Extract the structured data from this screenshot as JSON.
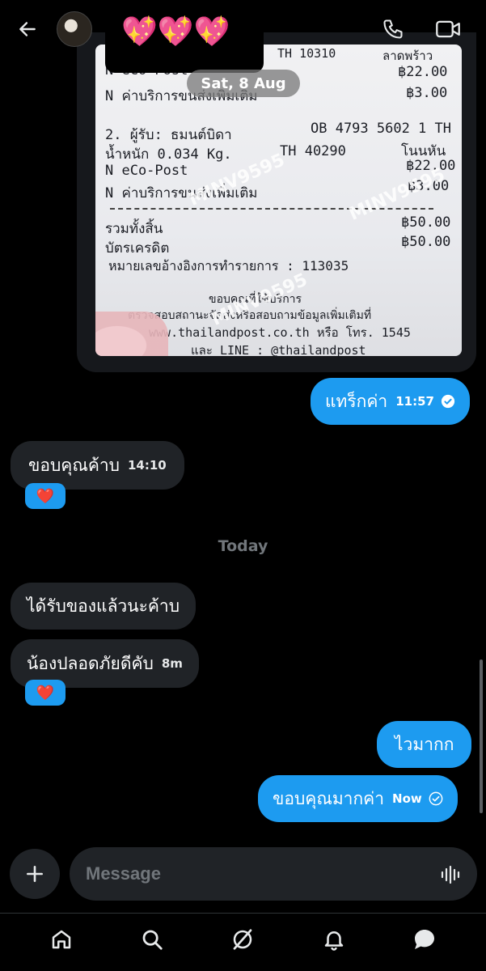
{
  "header": {
    "back_icon": "arrow-left-icon",
    "contact_name": "💖💖💖",
    "call_icon": "phone-icon",
    "video_icon": "video-camera-icon"
  },
  "media": {
    "receipt_lines": [
      "N eCo-Post",
      "N ค่าบริการขนส่งเพิ่มเติม",
      "2. ผู้รับ: ธมนต์บิดา",
      "น้ำหนัก 0.034 Kg.",
      "N eCo-Post",
      "N ค่าบริการขนส่งเพิ่มเติม",
      "รวมทั้งสิ้น",
      "บัตรเครดิต",
      "หมายเลขอ้างอิงการทำรายการ : 113035",
      "ขอบคุณที่ใช้บริการ",
      "ตรวจสอบสถานะจัดส่งหรือสอบถามข้อมูลเพิ่มเติมที่",
      "www.thailandpost.co.th หรือ โทร. 1545",
      "และ LINE : @thailandpost"
    ],
    "receipt_right": [
      "TH 10310",
      "ลาดพร้าว",
      "฿22.00",
      "฿3.00",
      "OB 4793 5602 1 TH",
      "TH 40290",
      "โนนหัน",
      "฿22.00",
      "฿3.00",
      "฿50.00",
      "฿50.00"
    ],
    "watermark": "MINV9595"
  },
  "date_pill": "Sat, 8 Aug",
  "messages": {
    "m1": {
      "text": "แทร็กค่า",
      "time": "11:57"
    },
    "m2": {
      "text": "ขอบคุณค้าบ",
      "time": "14:10",
      "reaction": "❤️"
    },
    "day_label": "Today",
    "m3": {
      "text": "ได้รับของแล้วนะค้าบ"
    },
    "m4": {
      "text": "น้องปลอดภัยดีคับ",
      "time": "8m",
      "reaction": "❤️"
    },
    "m5": {
      "text": "ไวมากก"
    },
    "m6": {
      "text": "ขอบคุณมากค่า",
      "time": "Now"
    }
  },
  "composer": {
    "placeholder": "Message",
    "add_icon": "plus-icon",
    "voice_icon": "voice-wave-icon"
  },
  "tabs": [
    {
      "name": "home-icon"
    },
    {
      "name": "search-icon"
    },
    {
      "name": "grok-icon"
    },
    {
      "name": "bell-icon"
    },
    {
      "name": "messages-icon"
    }
  ]
}
